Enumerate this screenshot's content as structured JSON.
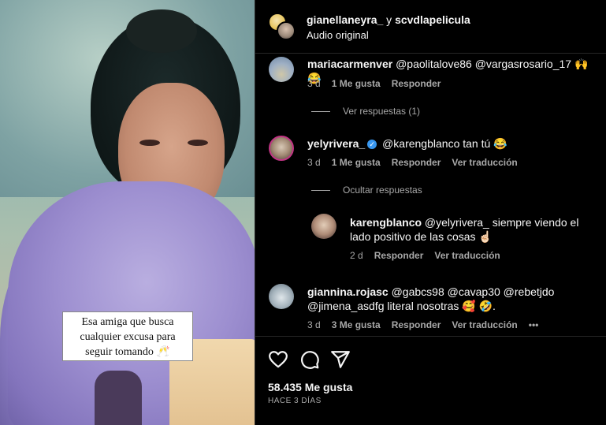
{
  "media": {
    "caption": "Esa amiga que busca cualquier excusa para seguir tomando 🥂"
  },
  "header": {
    "user1": "gianellaneyra_",
    "joiner": " y ",
    "user2": "scvdlapelicula",
    "audio": "Audio original"
  },
  "comments": [
    {
      "username": "mariacarmenver",
      "text": "@paolitalove86 @vargasrosario_17 🙌 😂",
      "time": "3 d",
      "likes": "1 Me gusta",
      "reply": "Responder",
      "replies_toggle": "Ver respuestas (1)"
    },
    {
      "username": "yelyrivera_",
      "verified": true,
      "text": "@karengblanco tan tú 😂",
      "time": "3 d",
      "likes": "1 Me gusta",
      "reply": "Responder",
      "translate": "Ver traducción",
      "replies_toggle": "Ocultar respuestas",
      "replies": [
        {
          "username": "karengblanco",
          "text": "@yelyrivera_ siempre viendo el lado positivo de las cosas ☝🏻",
          "time": "2 d",
          "reply": "Responder",
          "translate": "Ver traducción"
        }
      ]
    },
    {
      "username": "giannina.rojasc",
      "text": "@gabcs98 @cavap30 @rebetjdo @jimena_asdfg literal nosotras 🥰 🤣.",
      "time": "3 d",
      "likes": "3 Me gusta",
      "reply": "Responder",
      "translate": "Ver traducción",
      "more": "•••"
    }
  ],
  "footer": {
    "likes": "58.435 Me gusta",
    "ago": "HACE 3 DÍAS"
  }
}
